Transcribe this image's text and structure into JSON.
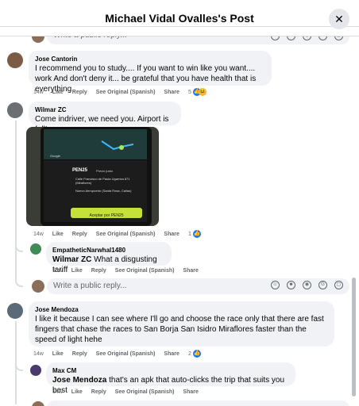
{
  "header": {
    "title": "Michael Vidal Ovalles's Post",
    "close_icon": "close-icon"
  },
  "reply_placeholder": "Write a public reply...",
  "reply_icons": [
    "avatar-sticker-icon",
    "emoji-icon",
    "camera-icon",
    "gif-icon",
    "sticker-icon"
  ],
  "actions": {
    "like": "Like",
    "reply": "Reply",
    "see_original": "See Original (Spanish)",
    "share": "Share"
  },
  "comments": [
    {
      "author": "Jose Cantorin",
      "text": "I recommend you to study.... If you want to win like you want.... work And don't deny it... be grateful that you have health that is everything",
      "time": "14w",
      "reactions": "5"
    },
    {
      "author": "Wilmar ZC",
      "text": "Come indriver, we need you. Airport is full!",
      "time": "14w",
      "reactions": "1",
      "screenshot": {
        "price": "PEN25",
        "price_label": "Precio justo",
        "pickup": "Calle Francisco de Paula Ugarriza 871 (Miraflores)",
        "dropoff": "Nuevo Aeropuerto (Santa Rosa, Callao)",
        "accept_button": "Aceptar por PEN25",
        "map_label": "Google"
      }
    },
    {
      "author": "EmpatheticNarwhal1480",
      "mention": "Wilmar ZC",
      "text": "What a disgusting tariff",
      "time": "13w"
    },
    {
      "author": "Jose Mendoza",
      "text": "I like it because I can see where I'll go and choose the race only that there are fast fingers that chase the races to San Borja San Isidro Miraflores faster than the speed of light hehe",
      "time": "14w",
      "reactions": "2"
    },
    {
      "author": "Max CM",
      "mention": "Jose Mendoza",
      "text": "that's an apk that auto-clicks the trip that suits you best",
      "time": "14w"
    }
  ],
  "colors": {
    "like_blue": "#1877f2",
    "bubble_bg": "#f0f2f5",
    "meta_gray": "#65676b",
    "accept_yellow": "#c6e03a"
  }
}
